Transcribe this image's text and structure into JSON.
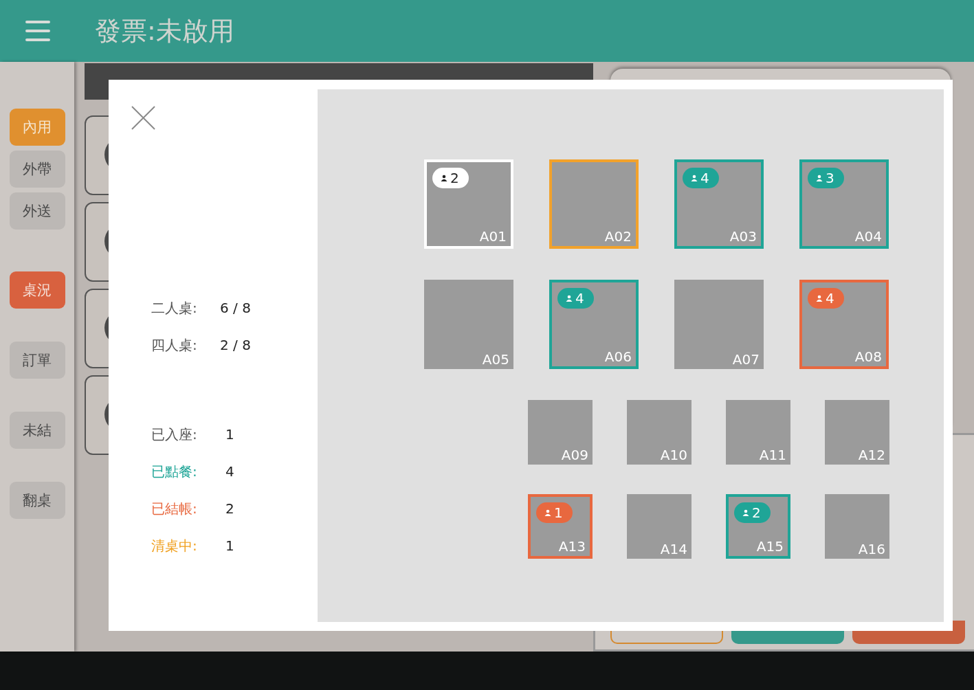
{
  "header": {
    "title": "發票:未啟用"
  },
  "sidebar": {
    "modes": [
      {
        "label": "內用",
        "selected": true
      },
      {
        "label": "外帶",
        "selected": false
      },
      {
        "label": "外送",
        "selected": false
      }
    ],
    "actions": [
      {
        "label": "桌況",
        "selected": true
      },
      {
        "label": "訂單",
        "selected": false
      },
      {
        "label": "未結",
        "selected": false
      },
      {
        "label": "翻桌",
        "selected": false
      }
    ]
  },
  "table_status_dialog": {
    "capacity": [
      {
        "label": "二人桌:",
        "value": "6 / 8"
      },
      {
        "label": "四人桌:",
        "value": "2 / 8"
      }
    ],
    "status_counts": [
      {
        "label": "已入座:",
        "value": "1",
        "color": "#555555"
      },
      {
        "label": "已點餐:",
        "value": "4",
        "color": "#1fa597"
      },
      {
        "label": "已結帳:",
        "value": "2",
        "color": "#e8683f"
      },
      {
        "label": "清桌中:",
        "value": "1",
        "color": "#f0a020"
      }
    ],
    "four_seat_tables": [
      {
        "name": "A01",
        "kind": "seated",
        "guests": "2"
      },
      {
        "name": "A02",
        "kind": "cleaning"
      },
      {
        "name": "A03",
        "kind": "ordered",
        "guests": "4"
      },
      {
        "name": "A04",
        "kind": "ordered",
        "guests": "3"
      },
      {
        "name": "A05",
        "kind": "empty"
      },
      {
        "name": "A06",
        "kind": "ordered",
        "guests": "4"
      },
      {
        "name": "A07",
        "kind": "empty"
      },
      {
        "name": "A08",
        "kind": "paid",
        "guests": "4"
      }
    ],
    "two_seat_tables": [
      {
        "name": "A09",
        "kind": "empty"
      },
      {
        "name": "A10",
        "kind": "empty"
      },
      {
        "name": "A11",
        "kind": "empty"
      },
      {
        "name": "A12",
        "kind": "empty"
      },
      {
        "name": "A13",
        "kind": "paid",
        "guests": "1"
      },
      {
        "name": "A14",
        "kind": "empty"
      },
      {
        "name": "A15",
        "kind": "ordered",
        "guests": "2"
      },
      {
        "name": "A16",
        "kind": "empty"
      }
    ]
  }
}
